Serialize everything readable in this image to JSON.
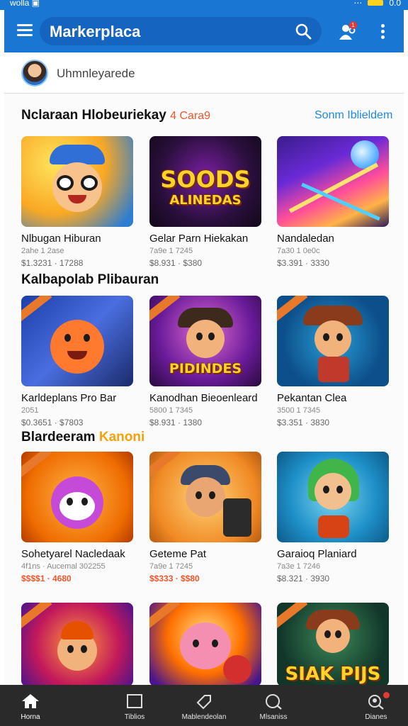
{
  "status_bar": {
    "left_text": "wolla ▣",
    "right_text": "0.0"
  },
  "app_bar": {
    "title": "Markerplaca",
    "notification_count": "1"
  },
  "user": {
    "name": "Uhmnleyarede"
  },
  "sections": [
    {
      "title": "Nclaraan Hlobeuriekay",
      "accent": "4 Cara9",
      "see_all": "Sonm Iblieldem",
      "items": [
        {
          "title": "Nlbugan Hiburan",
          "meta": "2ahe 1 2ase",
          "price": "$1.3231 · 17288"
        },
        {
          "title": "Gelar Parn Hiekakan",
          "meta": "7a9e 1 7245",
          "price": "$8.931 · $380"
        },
        {
          "title": "Nandaledan",
          "meta": "7a30 1 0e0c",
          "price": "$3.391 · 3330"
        }
      ]
    },
    {
      "title": "Kalbapolab Plibauran",
      "accent": "",
      "see_all": "",
      "items": [
        {
          "title": "Karldeplans Pro Bar",
          "meta": "2051",
          "price": "$0.3651 · $7803"
        },
        {
          "title": "Kanodhan Bieoenleard",
          "meta": "5800 1 7345",
          "price": "$8.931 · 1380"
        },
        {
          "title": "Pekantan Clea",
          "meta": "3500 1 7345",
          "price": "$3.351 · 3830"
        }
      ]
    },
    {
      "title": "Blardeeram",
      "accent": "Kanoni",
      "see_all": "",
      "items": [
        {
          "title": "Sohetyarel Nacledaak",
          "meta": "4f1ns · Aucemal 302255",
          "price": "$$$$1 · 4680"
        },
        {
          "title": "Geteme Pat",
          "meta": "7a9e 1 7245",
          "price": "$$333 · $$80"
        },
        {
          "title": "Garaioq Planiard",
          "meta": "7a3e 1 7246",
          "price": "$8.321 · 3930"
        }
      ]
    },
    {
      "title": "",
      "accent": "",
      "see_all": "",
      "items": [
        {
          "thumb_text": ""
        },
        {
          "thumb_text": ""
        },
        {
          "thumb_text": "SIAK PIJS"
        }
      ]
    }
  ],
  "thumb_texts": {
    "s1_1": "SOODS",
    "s1_2": "ALINEDAS",
    "s2_1": "PIDINDES"
  },
  "bottom_nav": [
    {
      "label": "Horna",
      "icon": "home-icon"
    },
    {
      "label": "Tiblios",
      "icon": "square-icon"
    },
    {
      "label": "Mablendeolan",
      "icon": "tag-icon"
    },
    {
      "label": "Mlsaniss",
      "icon": "chat-search-icon"
    },
    {
      "label": "Dianes",
      "icon": "profile-search-icon"
    }
  ],
  "colors": {
    "primary": "#1976d2",
    "accent": "#f2572c",
    "link": "#1e88e5",
    "nav_bg": "#2a2a2a"
  }
}
